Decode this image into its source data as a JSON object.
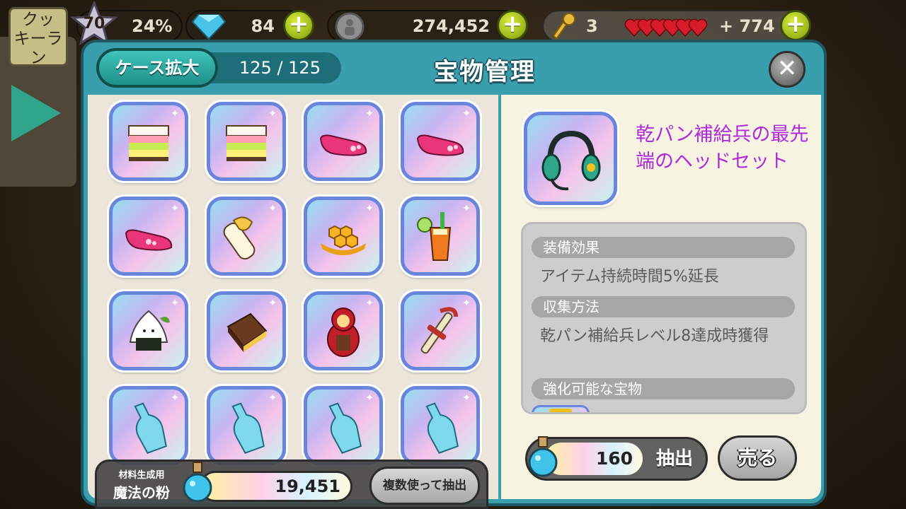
{
  "hud": {
    "level": "70",
    "exp_percent": "24%",
    "crystals": "84",
    "coins": "274,452",
    "keys": "3",
    "hearts_extra": "+ 774"
  },
  "side": {
    "cookie_run_label": "クッ\nキーラ\nン"
  },
  "panel": {
    "case_expand_label": "ケース拡大",
    "case_count": "125 / 125",
    "title": "宝物管理",
    "close_label": "✕"
  },
  "grid": {
    "items": [
      {
        "icon": "rainbow-cake-icon"
      },
      {
        "icon": "rainbow-cake-icon"
      },
      {
        "icon": "pink-shoe-icon"
      },
      {
        "icon": "pink-shoe-icon"
      },
      {
        "icon": "pink-shoe-icon"
      },
      {
        "icon": "butter-roll-icon"
      },
      {
        "icon": "honeycomb-icon"
      },
      {
        "icon": "juice-glass-icon"
      },
      {
        "icon": "rice-ball-icon"
      },
      {
        "icon": "chocolate-box-icon"
      },
      {
        "icon": "matryoshka-icon"
      },
      {
        "icon": "bone-sword-icon"
      },
      {
        "icon": "soda-bottle-icon"
      },
      {
        "icon": "soda-bottle-icon"
      },
      {
        "icon": "soda-bottle-icon"
      },
      {
        "icon": "soda-bottle-icon"
      }
    ]
  },
  "powder": {
    "label_small": "材料生成用",
    "label_big": "魔法の粉",
    "value": "19,451",
    "multi_extract_label": "複数使って抽出"
  },
  "detail": {
    "icon": "headset-icon",
    "item_name": "乾パン補給兵の最先端のヘッドセット",
    "effect_header": "装備効果",
    "effect_text": "アイテム持続時間5%延長",
    "obtain_header": "収集方法",
    "obtain_text": "乾パン補給兵レベル8達成時獲得",
    "upgrade_header": "強化可能な宝物",
    "extract_count": "160",
    "extract_label": "抽出",
    "sell_label": "売る"
  },
  "colors": {
    "frame": "#3a9fad",
    "title_purple": "#b02ad9",
    "plus_green": "#98b51a"
  }
}
